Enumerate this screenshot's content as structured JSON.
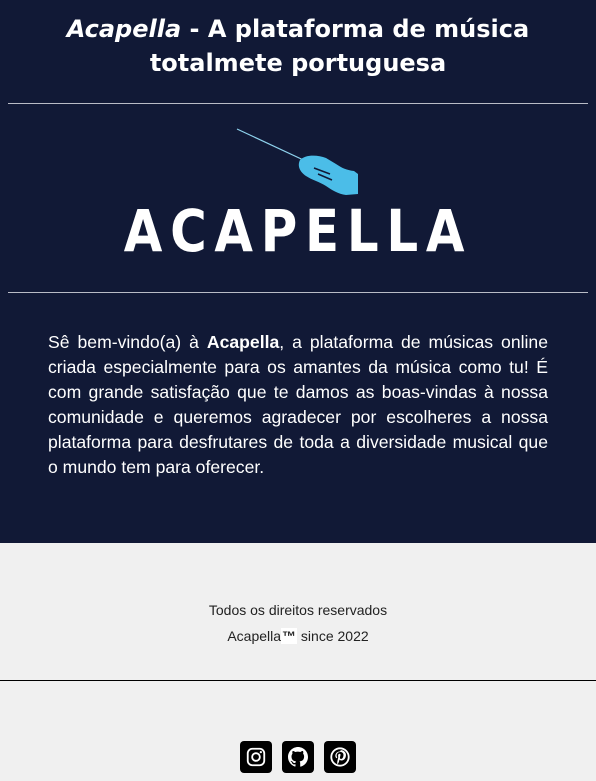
{
  "header": {
    "brand": "Acapella",
    "separator": " - ",
    "tagline": "A plataforma de música totalmete portuguesa"
  },
  "logo": {
    "text": "ACAPELLA"
  },
  "intro": {
    "pre": "Sê bem-vindo(a) à ",
    "brand": "Acapella",
    "post": ", a plataforma de músicas online criada especialmente para os amantes da música como tu! É com grande satisfação que te damos as boas-vindas à nossa comunidade e queremos agradecer por escolheres a nossa plataforma para desfrutares de toda a diversidade musical que o mundo tem para oferecer."
  },
  "footer": {
    "rights": "Todos os direitos reservados",
    "brand": "Acapella",
    "tm": "™",
    "since": " since 2022"
  },
  "socials": [
    {
      "icon": "instagram-icon"
    },
    {
      "icon": "github-icon"
    },
    {
      "icon": "pinterest-icon"
    }
  ],
  "colors": {
    "hero_bg": "#111936",
    "accent_hand": "#4bbde8"
  }
}
